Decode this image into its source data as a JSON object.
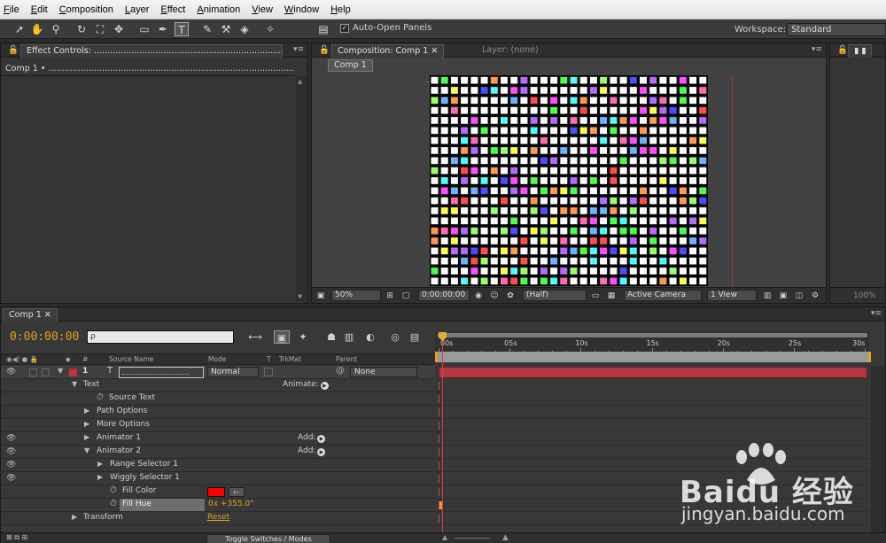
{
  "menu": [
    "File",
    "Edit",
    "Composition",
    "Layer",
    "Effect",
    "Animation",
    "View",
    "Window",
    "Help"
  ],
  "toolbar": {
    "auto_open_label": "Auto-Open Panels",
    "workspace_label": "Workspace:",
    "workspace_value": "Standard"
  },
  "effect_controls": {
    "tab": "Effect Controls: .............................................................................",
    "comp_line": "Comp 1 • ............................................................................................"
  },
  "composition": {
    "tab": "Composition: Comp 1",
    "layer_tab": "Layer: (none)",
    "subtab": "Comp 1",
    "zoom": "50%",
    "timecode": "0:00:00:00",
    "resolution": "(Half)",
    "camera": "Active Camera",
    "view": "1 View"
  },
  "right_panel": {
    "zoom": "100%"
  },
  "timeline": {
    "tab": "Comp 1",
    "time": "0:00:00:00",
    "search_placeholder": "ρ",
    "headers": {
      "num": "#",
      "source": "Source Name",
      "mode": "Mode",
      "t": "T",
      "trkmat": "TrkMat",
      "parent": "Parent"
    },
    "layer": {
      "num": "1",
      "name": "..............................",
      "mode": "Normal",
      "parent": "None"
    },
    "rows": {
      "text": "Text",
      "animate": "Animate:",
      "source_text": "Source Text",
      "path_options": "Path Options",
      "more_options": "More Options",
      "animator1": "Animator 1",
      "animator2": "Animator 2",
      "add": "Add:",
      "range_selector": "Range Selector 1",
      "wiggly_selector": "Wiggly Selector 1",
      "fill_color": "Fill Color",
      "fill_hue": "Fill Hue",
      "fill_hue_value": "0x +355.0°",
      "transform": "Transform",
      "reset": "Reset"
    },
    "ruler": [
      "00s",
      "05s",
      "10s",
      "15s",
      "20s",
      "25s",
      "30s"
    ],
    "toggle_label": "Toggle Switches / Modes"
  },
  "colors": {
    "accent_orange": "#e0a020",
    "layer_red": "#c0303a",
    "fill_color": "#ff0000",
    "grid_palette": [
      "#ff4d4d",
      "#4dff4d",
      "#4d4dff",
      "#ffff4d",
      "#ff4dff",
      "#4dffff",
      "#ff9a4d",
      "#b36bff",
      "#6bb3ff",
      "#ff6bb3",
      "#9aff6b",
      "#ffffff"
    ]
  },
  "watermark": {
    "brand": "Bai",
    "brand_cn": "经验",
    "url": "jingyan.baidu.com"
  }
}
